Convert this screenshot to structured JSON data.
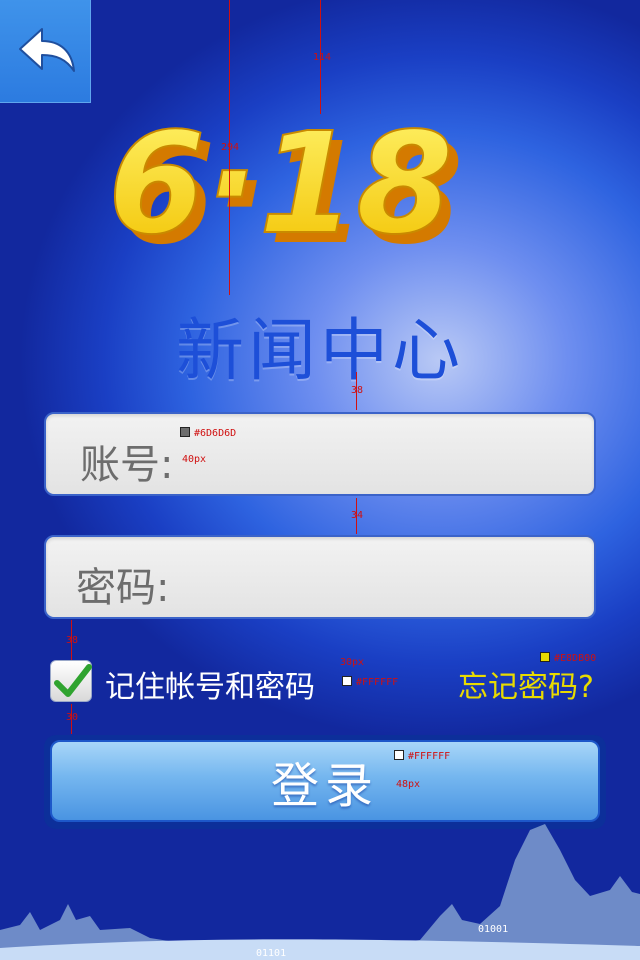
{
  "header": {
    "back_icon": "back-arrow-icon"
  },
  "logo": {
    "text": "6·18"
  },
  "title": "新闻中心",
  "form": {
    "username_label": "账号:",
    "password_label": "密码:",
    "remember_label": "记住帐号和密码",
    "remember_checked": true,
    "forgot_label": "忘记密码?",
    "login_label": "登录"
  },
  "colors": {
    "field_text": "#6D6D6D",
    "remember_text": "#FFFFFF",
    "forgot_text": "#E8DB00",
    "login_text": "#FFFFFF"
  },
  "annotations": {
    "dim_114": "114",
    "dim_294": "294",
    "dim_38a": "38",
    "dim_34": "34",
    "dim_38b": "38",
    "dim_30": "30",
    "field_color": "#6D6D6D",
    "field_size": "40px",
    "remember_size": "30px",
    "remember_color": "#FFFFFF",
    "forgot_color": "#E8DB00",
    "login_color": "#FFFFFF",
    "login_size": "48px"
  },
  "footer": {
    "tag_left": "01101",
    "tag_right": "01001"
  }
}
